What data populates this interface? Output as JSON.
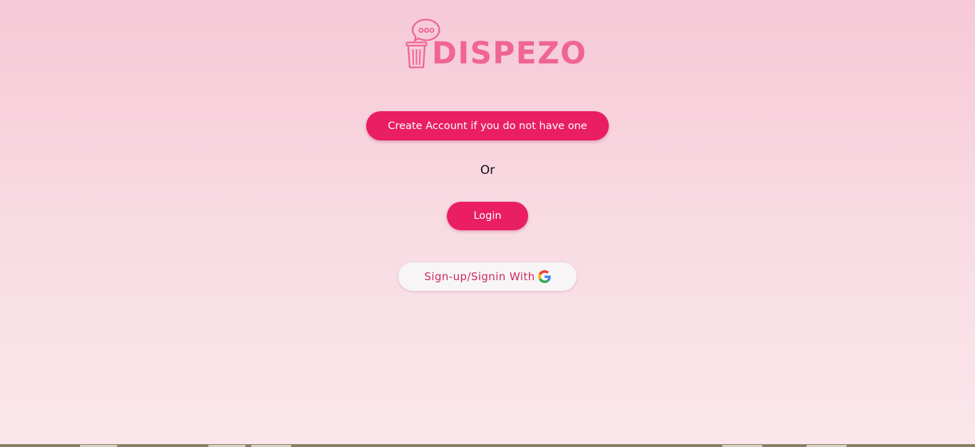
{
  "brand": {
    "name": "DISPEZO",
    "logo_icon": "trash-can-speech-bubble-icon",
    "color": "#ef6594"
  },
  "actions": {
    "create_account_label": "Create Account if you do not have one",
    "or_label": "Or",
    "login_label": "Login",
    "google_label": "Sign-up/Signin With",
    "google_icon": "google-g-icon"
  },
  "colors": {
    "primary_button": "#e91e63",
    "google_button_bg": "#f7f5f6",
    "google_button_text": "#cf2a5c",
    "background_top": "#f6c9d7",
    "background_bottom": "#fbe7eb"
  }
}
